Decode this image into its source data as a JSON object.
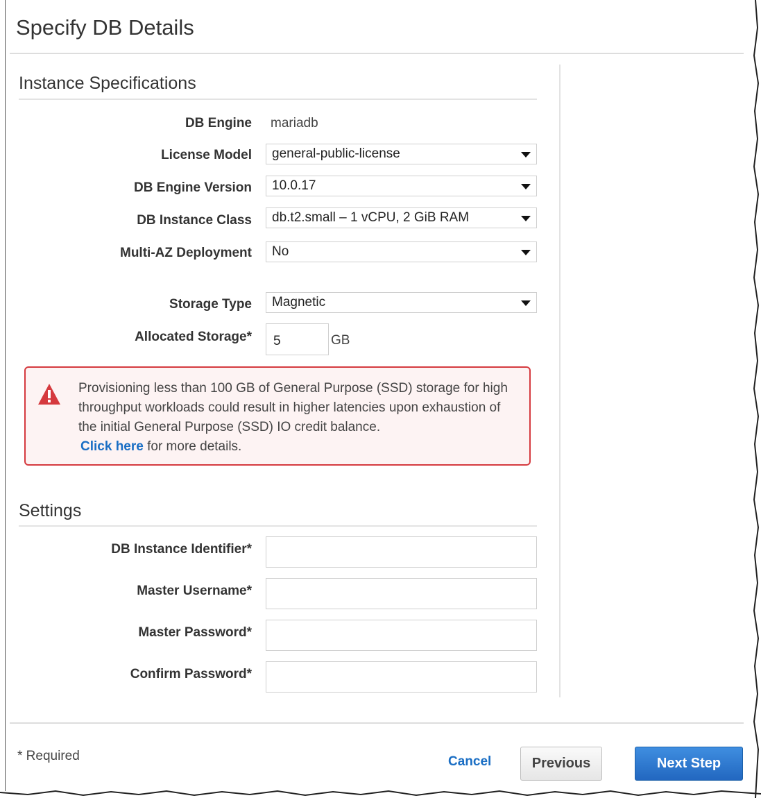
{
  "page": {
    "title": "Specify DB Details"
  },
  "instance_specs": {
    "title": "Instance Specifications",
    "db_engine": {
      "label": "DB Engine",
      "value": "mariadb"
    },
    "license_model": {
      "label": "License Model",
      "value": "general-public-license"
    },
    "engine_version": {
      "label": "DB Engine Version",
      "value": "10.0.17"
    },
    "instance_class": {
      "label": "DB Instance Class",
      "value": "db.t2.small – 1 vCPU, 2 GiB RAM"
    },
    "multi_az": {
      "label": "Multi-AZ Deployment",
      "value": "No"
    },
    "storage_type": {
      "label": "Storage Type",
      "value": "Magnetic"
    },
    "allocated_storage": {
      "label": "Allocated Storage*",
      "value": "5",
      "unit": "GB"
    }
  },
  "alert": {
    "text": "Provisioning less than 100 GB of General Purpose (SSD) storage for high throughput workloads could result in higher latencies upon exhaustion of the initial General Purpose (SSD) IO credit balance.",
    "link_label": "Click here",
    "link_suffix": "for more details.",
    "icon": "warning-triangle-icon",
    "color": "#d5393e"
  },
  "settings": {
    "title": "Settings",
    "identifier": {
      "label": "DB Instance Identifier*",
      "value": ""
    },
    "username": {
      "label": "Master Username*",
      "value": ""
    },
    "password": {
      "label": "Master Password*",
      "value": ""
    },
    "confirm_password": {
      "label": "Confirm Password*",
      "value": ""
    }
  },
  "footer": {
    "required_note": "* Required",
    "cancel_label": "Cancel",
    "previous_label": "Previous",
    "next_label": "Next Step",
    "primary_color": "#2267c0"
  }
}
